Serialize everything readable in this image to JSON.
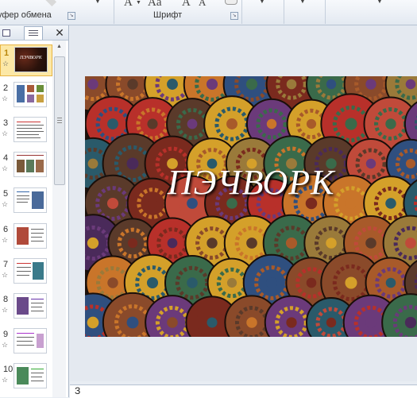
{
  "ribbon": {
    "clipboard_label": "уфер обмена",
    "font_label": "Шрифт",
    "font_grow_glyph": "A",
    "font_case_glyph": "Aa",
    "font_size_up_glyph": "A",
    "font_size_down_glyph": "A"
  },
  "panel": {
    "close_glyph": "✕"
  },
  "slides": [
    {
      "number": "1",
      "thumb_title": "ПЭЧВОРК"
    },
    {
      "number": "2"
    },
    {
      "number": "3"
    },
    {
      "number": "4"
    },
    {
      "number": "5"
    },
    {
      "number": "6"
    },
    {
      "number": "7"
    },
    {
      "number": "8"
    },
    {
      "number": "9"
    },
    {
      "number": "10"
    }
  ],
  "slide": {
    "title": "ПЭЧВОРК"
  },
  "notes": {
    "text": "З"
  }
}
